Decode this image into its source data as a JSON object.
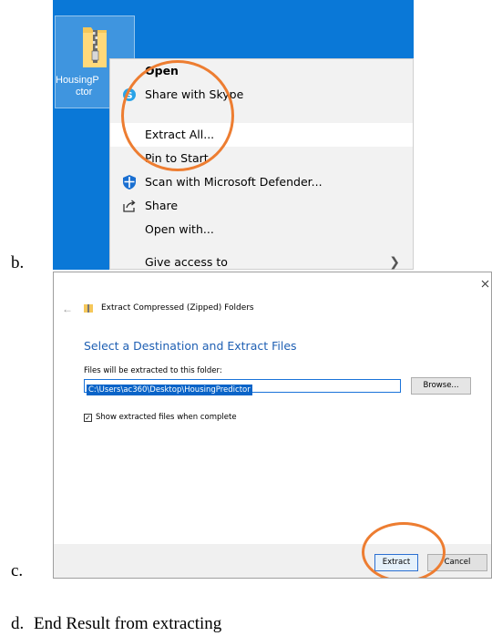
{
  "markers": {
    "b": "b.",
    "c": "c.",
    "d": "d."
  },
  "caption": "End Result from extracting",
  "desktop": {
    "file_label_line1": "HousingP",
    "file_label_line2": "ctor",
    "file_icon": "zip-folder-icon"
  },
  "context_menu": {
    "items": [
      {
        "label": "Open",
        "icon": ""
      },
      {
        "label": "Share with Skype",
        "icon": "skype-icon"
      },
      {
        "label": "Extract All...",
        "icon": ""
      },
      {
        "label": "Pin to Start",
        "icon": ""
      },
      {
        "label": "Scan with Microsoft Defender...",
        "icon": "defender-icon"
      },
      {
        "label": "Share",
        "icon": "share-icon"
      },
      {
        "label": "Open with...",
        "icon": ""
      },
      {
        "label": "Give access to",
        "icon": "chevron-right-icon"
      }
    ]
  },
  "dialog": {
    "title": "Extract Compressed (Zipped) Folders",
    "heading": "Select a Destination and Extract Files",
    "path_label": "Files will be extracted to this folder:",
    "path_value": "C:\\Users\\ac360\\Desktop\\HousingPredictor",
    "browse_label": "Browse...",
    "checkbox_label": "Show extracted files when complete",
    "checkbox_checked": true,
    "extract_label": "Extract",
    "cancel_label": "Cancel"
  },
  "colors": {
    "desktop_blue": "#0a78d7",
    "annotation_orange": "#ed7d31",
    "heading_blue": "#1e5fb3"
  }
}
